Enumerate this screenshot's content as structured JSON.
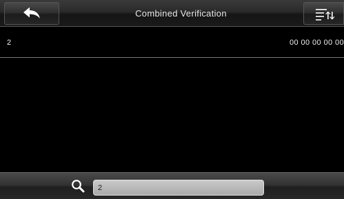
{
  "header": {
    "title": "Combined Verification",
    "back_icon": "back-arrow-icon",
    "menu_icon": "sort-menu-icon"
  },
  "list": {
    "rows": [
      {
        "id": "2",
        "value": "00 00 00 00 00"
      }
    ]
  },
  "footer": {
    "search_icon": "search-icon",
    "search_value": "2"
  },
  "colors": {
    "background": "#000000",
    "bar_gradient_top": "#3a3a3a",
    "bar_gradient_bottom": "#1a1a1a",
    "search_field": "#bdbdbd",
    "divider": "#7a7a7a"
  }
}
